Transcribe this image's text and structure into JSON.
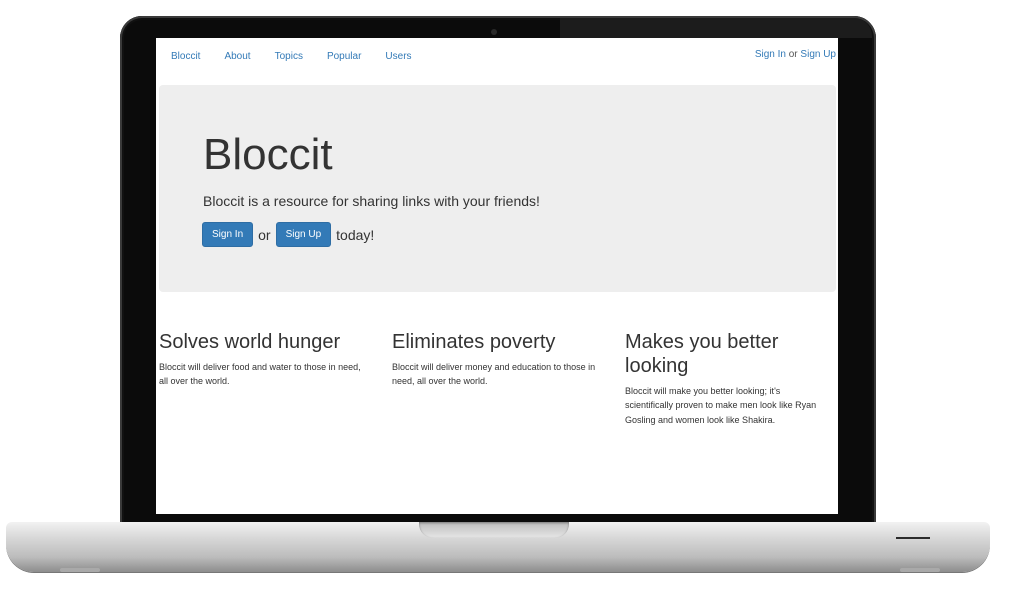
{
  "navbar": {
    "items": [
      {
        "label": "Bloccit"
      },
      {
        "label": "About"
      },
      {
        "label": "Topics"
      },
      {
        "label": "Popular"
      },
      {
        "label": "Users"
      }
    ],
    "sign_in": "Sign In",
    "or": "or",
    "sign_up": "Sign Up"
  },
  "jumbotron": {
    "title": "Bloccit",
    "lead": "Bloccit is a resource for sharing links with your friends!",
    "sign_in_button": "Sign In",
    "or": "or",
    "sign_up_button": "Sign Up",
    "suffix": "today!"
  },
  "features": [
    {
      "title": "Solves world hunger",
      "text": "Bloccit will deliver food and water to those in need, all over the world."
    },
    {
      "title": "Eliminates poverty",
      "text": "Bloccit will deliver money and education to those in need, all over the world."
    },
    {
      "title": "Makes you better looking",
      "text": "Bloccit will make you better looking; it's scientifically proven to make men look like Ryan Gosling and women look like Shakira."
    }
  ],
  "colors": {
    "link": "#337ab7",
    "button": "#337ab7",
    "jumbotron_bg": "#eeeeee"
  }
}
